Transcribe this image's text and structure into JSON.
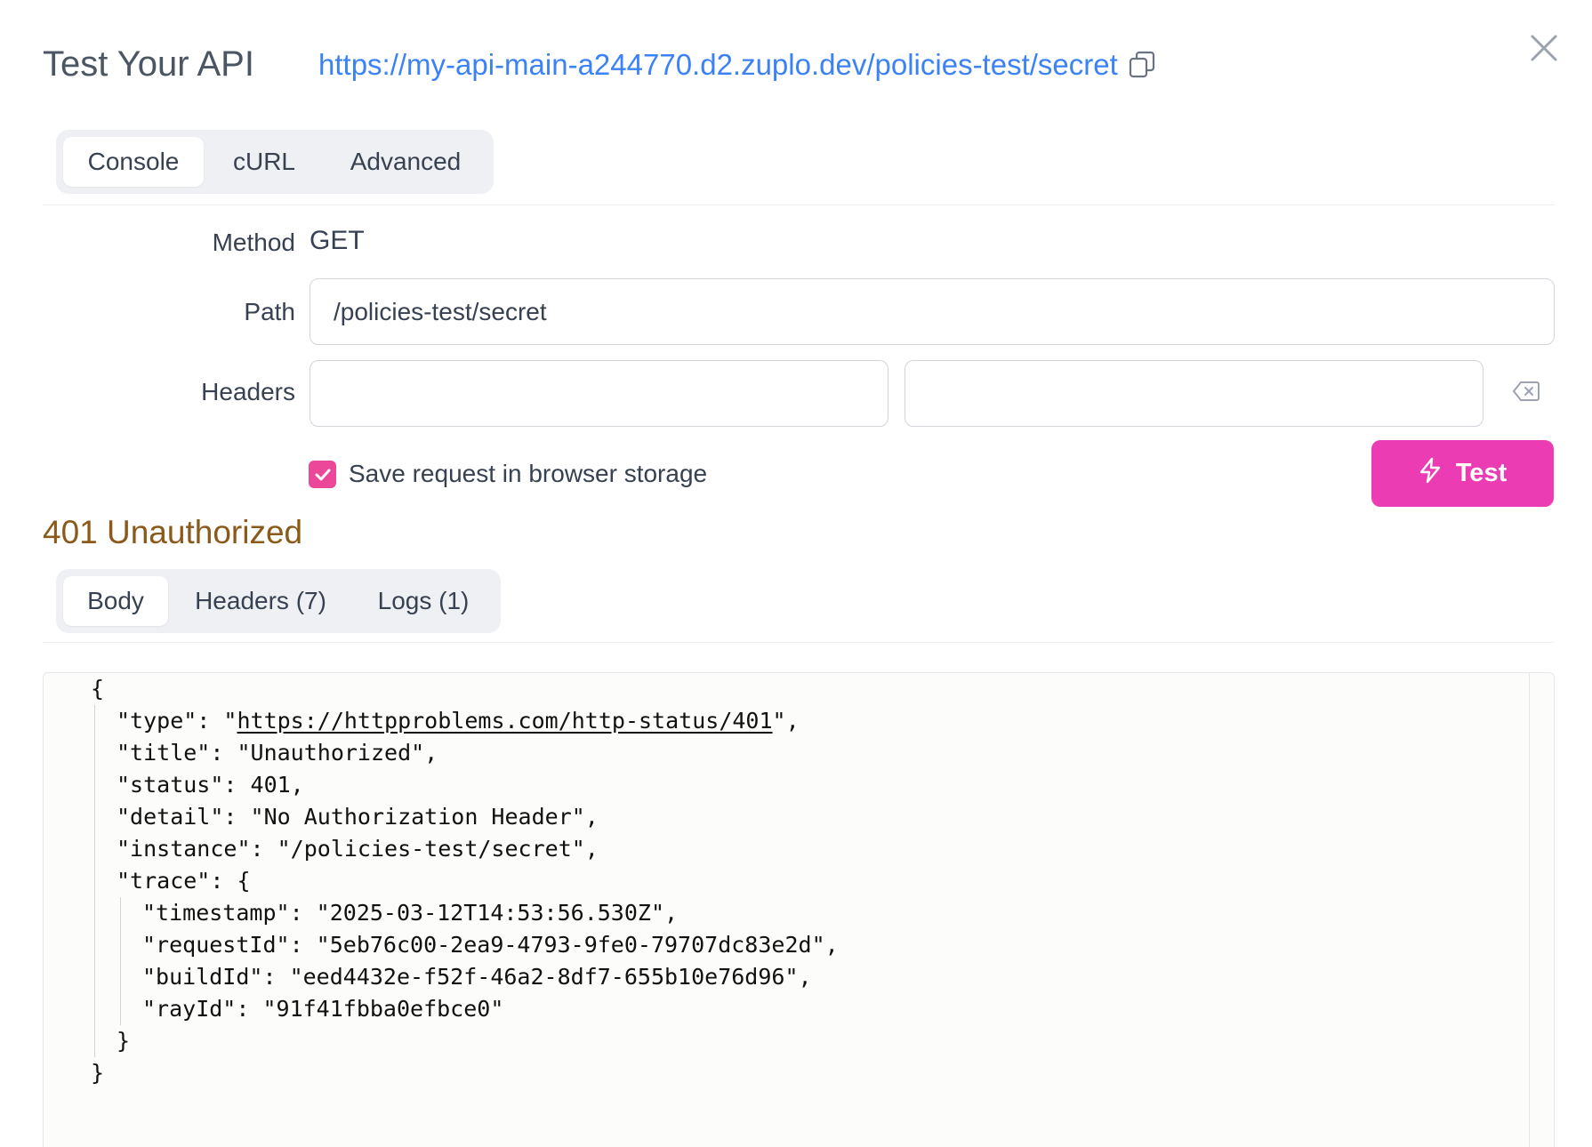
{
  "dialog": {
    "title": "Test Your API",
    "url": "https://my-api-main-a244770.d2.zuplo.dev/policies-test/secret"
  },
  "request_tabs": [
    {
      "label": "Console",
      "active": true
    },
    {
      "label": "cURL",
      "active": false
    },
    {
      "label": "Advanced",
      "active": false
    }
  ],
  "form": {
    "method_label": "Method",
    "method_value": "GET",
    "path_label": "Path",
    "path_value": "/policies-test/secret",
    "headers_label": "Headers",
    "header_key_value": "",
    "header_value_value": "",
    "save_checkbox_label": "Save request in browser storage",
    "save_checked": true,
    "test_button_label": "Test"
  },
  "response": {
    "status_text": "401 Unauthorized",
    "tabs": [
      {
        "label": "Body",
        "active": true
      },
      {
        "label": "Headers (7)",
        "active": false
      },
      {
        "label": "Logs (1)",
        "active": false
      }
    ],
    "body_lines": {
      "l1": "{",
      "l2_pre": "\"type\": \"",
      "l2_link": "https://httpproblems.com/http-status/401",
      "l2_post": "\",",
      "l3": "\"title\": \"Unauthorized\",",
      "l4": "\"status\": 401,",
      "l5": "\"detail\": \"No Authorization Header\",",
      "l6": "\"instance\": \"/policies-test/secret\",",
      "l7": "\"trace\": {",
      "l8": "\"timestamp\": \"2025-03-12T14:53:56.530Z\",",
      "l9": "\"requestId\": \"5eb76c00-2ea9-4793-9fe0-79707dc83e2d\",",
      "l10": "\"buildId\": \"eed4432e-f52f-46a2-8df7-655b10e76d96\",",
      "l11": "\"rayId\": \"91f41fbba0efbce0\"",
      "l12": "}",
      "l13": "}"
    }
  },
  "colors": {
    "accent": "#ec3cb4",
    "link": "#3b82f6",
    "status_error": "#8b5a1a"
  },
  "icons": [
    "copy-icon",
    "close-icon",
    "clear-header-icon",
    "check-icon",
    "lightning-icon"
  ]
}
